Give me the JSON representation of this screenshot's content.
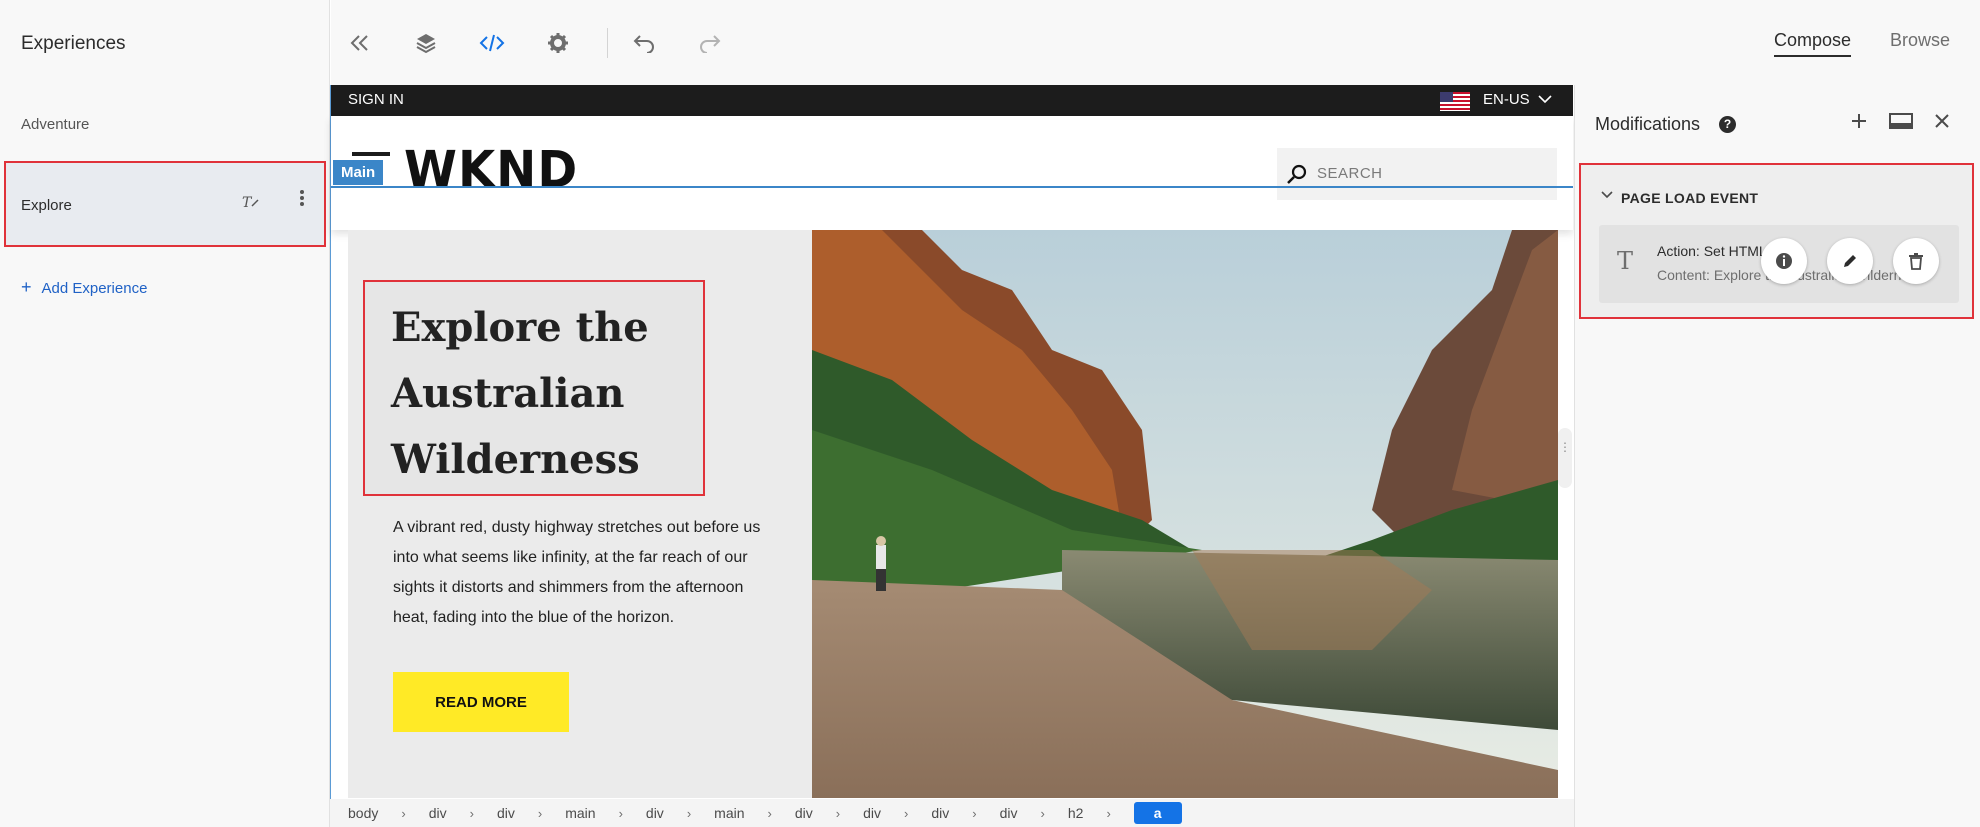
{
  "left_panel": {
    "title": "Experiences",
    "experiences": [
      {
        "label": "Adventure"
      },
      {
        "label": "Explore"
      }
    ],
    "add_label": "Add Experience"
  },
  "toolbar": {
    "icons": [
      "collapse-icon",
      "layers-icon",
      "code-icon",
      "settings-icon",
      "undo-icon",
      "redo-icon"
    ],
    "tabs": {
      "compose": "Compose",
      "browse": "Browse"
    }
  },
  "site": {
    "sign_in": "SIGN IN",
    "locale": "EN-US",
    "logo": "WKND",
    "highlight_tag": "Main",
    "search_placeholder": "SEARCH",
    "hero_title": "Explore the Australian Wilderness",
    "hero_text": "A vibrant red, dusty highway stretches out before us into what seems like infinity, at the far reach of our sights it distorts and shimmers from the afternoon heat, fading into the blue of the horizon.",
    "read_more": "READ MORE"
  },
  "breadcrumb": [
    "body",
    "div",
    "div",
    "main",
    "div",
    "main",
    "div",
    "div",
    "div",
    "div",
    "h2",
    "a"
  ],
  "right_panel": {
    "title": "Modifications",
    "event_title": "PAGE LOAD EVENT",
    "action_line": "Action: Set HTML",
    "content_line": "Content: Explore the Australian Wilderness"
  },
  "colors": {
    "highlight": "#e0323a",
    "accent_blue": "#1473e6",
    "read_more_bg": "#ffea26"
  }
}
